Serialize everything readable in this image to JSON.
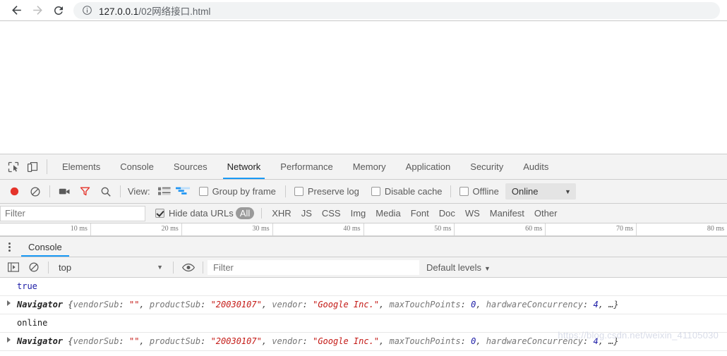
{
  "browser": {
    "back_label": "Back",
    "forward_label": "Forward",
    "reload_label": "Reload",
    "info_label": "View site information",
    "url_host": "127.0.0.1",
    "url_path": "/02网络接口.html"
  },
  "devtools": {
    "inspect_icon": "inspect-element-icon",
    "device_icon": "device-toolbar-icon",
    "tabs": [
      {
        "label": "Elements",
        "active": false
      },
      {
        "label": "Console",
        "active": false
      },
      {
        "label": "Sources",
        "active": false
      },
      {
        "label": "Network",
        "active": true
      },
      {
        "label": "Performance",
        "active": false
      },
      {
        "label": "Memory",
        "active": false
      },
      {
        "label": "Application",
        "active": false
      },
      {
        "label": "Security",
        "active": false
      },
      {
        "label": "Audits",
        "active": false
      }
    ]
  },
  "network_toolbar": {
    "record_label": "Stop recording network log",
    "clear_label": "Clear",
    "capture_screenshots_label": "Capture screenshots",
    "filter_toggle_label": "Filter",
    "search_label": "Search",
    "view_label": "View:",
    "view_list_label": "Use large request rows",
    "view_waterfall_label": "Show overview",
    "group_by_frame": {
      "label": "Group by frame",
      "checked": false
    },
    "preserve_log": {
      "label": "Preserve log",
      "checked": false
    },
    "disable_cache": {
      "label": "Disable cache",
      "checked": false
    },
    "offline": {
      "label": "Offline",
      "checked": false
    },
    "throttling_value": "Online",
    "throttling_caret": "▼"
  },
  "filter_row": {
    "filter_placeholder": "Filter",
    "filter_value": "",
    "hide_data_urls": {
      "label": "Hide data URLs",
      "checked": true
    },
    "types": [
      {
        "label": "All",
        "active": true
      },
      {
        "label": "XHR",
        "active": false
      },
      {
        "label": "JS",
        "active": false
      },
      {
        "label": "CSS",
        "active": false
      },
      {
        "label": "Img",
        "active": false
      },
      {
        "label": "Media",
        "active": false
      },
      {
        "label": "Font",
        "active": false
      },
      {
        "label": "Doc",
        "active": false
      },
      {
        "label": "WS",
        "active": false
      },
      {
        "label": "Manifest",
        "active": false
      },
      {
        "label": "Other",
        "active": false
      }
    ]
  },
  "timeline": {
    "ticks": [
      "10 ms",
      "20 ms",
      "30 ms",
      "40 ms",
      "50 ms",
      "60 ms",
      "70 ms",
      "80 ms",
      ""
    ]
  },
  "drawer": {
    "menu_label": "More tools",
    "tabs": [
      {
        "label": "Console",
        "active": true
      }
    ]
  },
  "console_toolbar": {
    "sidebar_toggle_label": "Show console sidebar",
    "clear_label": "Clear console",
    "context_value": "top",
    "context_caret": "▼",
    "eye_label": "Create live expression",
    "filter_placeholder": "Filter",
    "filter_value": "",
    "levels_label": "Default levels",
    "levels_caret": "▼"
  },
  "console_messages": [
    {
      "kind": "value",
      "value_class": "bool",
      "text": "true"
    },
    {
      "kind": "object",
      "expandable": true,
      "ctor": "Navigator",
      "open": " {",
      "props": [
        {
          "key": "vendorSub",
          "sep": ": ",
          "value": "\"\"",
          "type": "string",
          "tail": ", "
        },
        {
          "key": "productSub",
          "sep": ": ",
          "value": "\"20030107\"",
          "type": "string",
          "tail": ", "
        },
        {
          "key": "vendor",
          "sep": ": ",
          "value": "\"Google Inc.\"",
          "type": "string",
          "tail": ", "
        },
        {
          "key": "maxTouchPoints",
          "sep": ": ",
          "value": "0",
          "type": "number",
          "tail": ", "
        },
        {
          "key": "hardwareConcurrency",
          "sep": ": ",
          "value": "4",
          "type": "number",
          "tail": ", "
        }
      ],
      "close": "…}"
    },
    {
      "kind": "value",
      "value_class": "plain",
      "text": "online"
    },
    {
      "kind": "object",
      "expandable": true,
      "ctor": "Navigator",
      "open": " {",
      "props": [
        {
          "key": "vendorSub",
          "sep": ": ",
          "value": "\"\"",
          "type": "string",
          "tail": ", "
        },
        {
          "key": "productSub",
          "sep": ": ",
          "value": "\"20030107\"",
          "type": "string",
          "tail": ", "
        },
        {
          "key": "vendor",
          "sep": ": ",
          "value": "\"Google Inc.\"",
          "type": "string",
          "tail": ", "
        },
        {
          "key": "maxTouchPoints",
          "sep": ": ",
          "value": "0",
          "type": "number",
          "tail": ", "
        },
        {
          "key": "hardwareConcurrency",
          "sep": ": ",
          "value": "4",
          "type": "number",
          "tail": ", "
        }
      ],
      "close": "…}"
    }
  ],
  "watermark": {
    "text": "https://blog.csdn.net/weixin_41105030"
  },
  "colors": {
    "accent_blue": "#1a9af5",
    "record_red": "#e5342b",
    "string_red": "#c41a16",
    "number_blue": "#1a1aa6",
    "toolbar_bg": "#f3f3f3"
  }
}
